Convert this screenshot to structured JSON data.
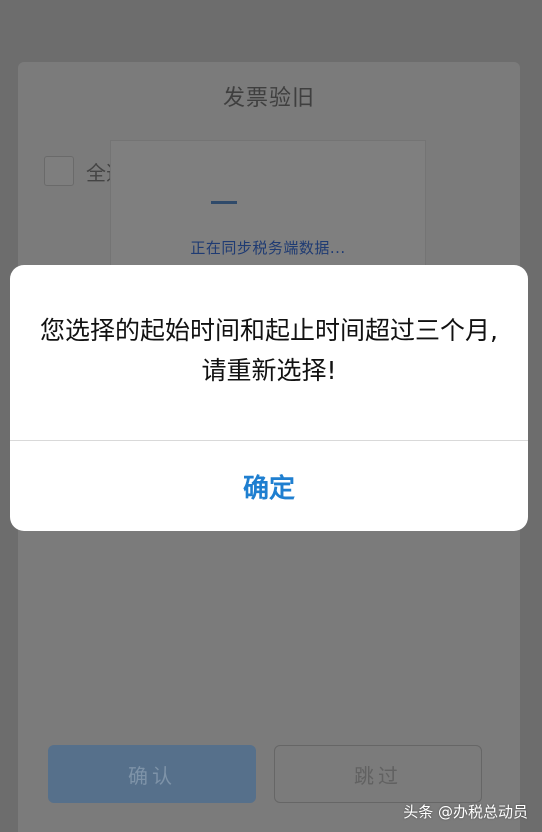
{
  "sheet": {
    "title": "发票验旧",
    "select_all_label": "全选"
  },
  "loading": {
    "text": "正在同步税务端数据..."
  },
  "buttons": {
    "confirm_label": "确认",
    "skip_label": "跳过"
  },
  "alert": {
    "message": "您选择的起始时间和起止时间超过三个月,请重新选择!",
    "button_label": "确定"
  },
  "watermark": {
    "text": "头条 @办税总动员"
  },
  "colors": {
    "alert_button": "#1f7fd0",
    "overlay": "#6d6d6d",
    "loading_text": "#1f3b73"
  }
}
